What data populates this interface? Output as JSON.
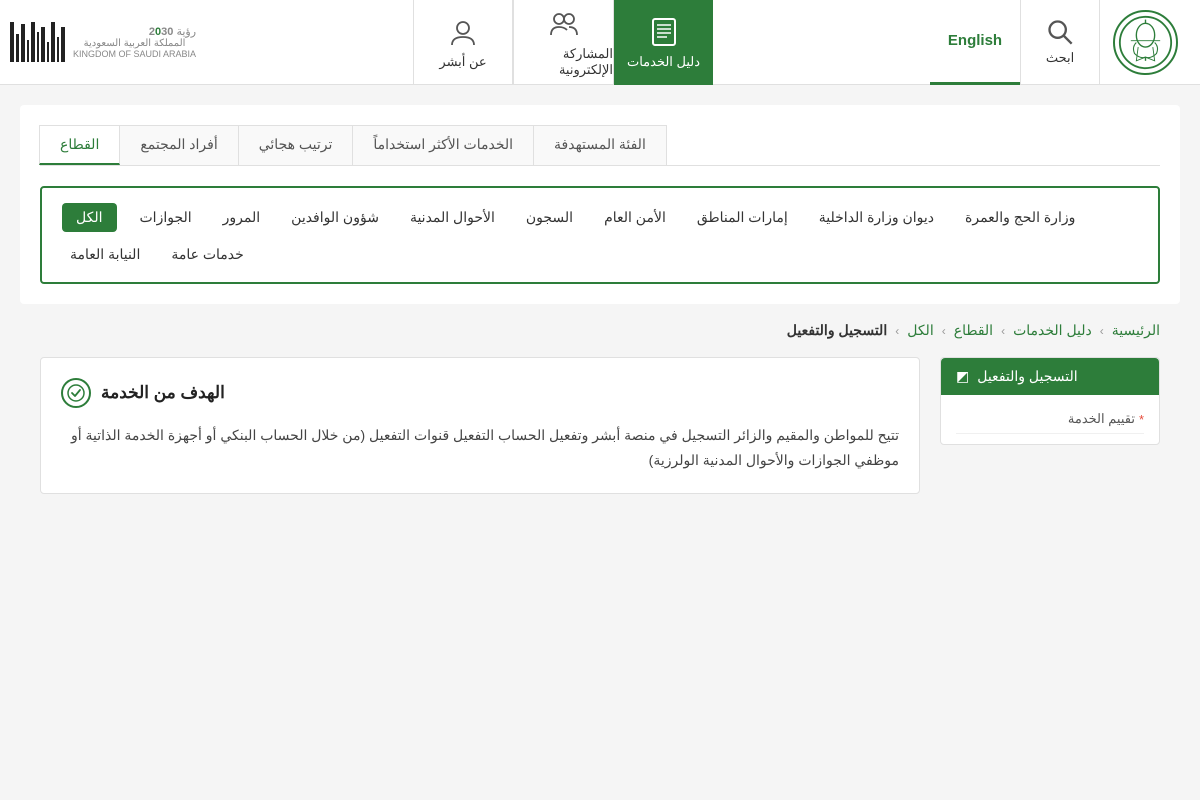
{
  "header": {
    "search_label": "ابحث",
    "english_label": "English",
    "nav_items": [
      {
        "id": "daleel",
        "label": "دليل الخدمات",
        "icon": "book",
        "active": true
      },
      {
        "id": "musharaka",
        "label": "المشاركة الإلكترونية",
        "icon": "people",
        "active": false
      },
      {
        "id": "absher",
        "label": "عن أبشر",
        "icon": "id",
        "active": false
      }
    ],
    "vision_line1": "رؤية",
    "vision_year": "2030",
    "vision_country": "المملكة العربية السعودية",
    "vision_en": "KINGDOM OF SAUDI ARABIA"
  },
  "filter_tabs": [
    {
      "id": "qita3",
      "label": "القطاع",
      "active": true
    },
    {
      "id": "afrad",
      "label": "أفراد المجتمع",
      "active": false
    },
    {
      "id": "tartib",
      "label": "ترتيب هجائي",
      "active": false
    },
    {
      "id": "akthar",
      "label": "الخدمات الأكثر استخداماً",
      "active": false
    },
    {
      "id": "fi2a",
      "label": "الفئة المستهدفة",
      "active": false
    }
  ],
  "categories": {
    "row1": [
      {
        "id": "all",
        "label": "الكل",
        "active": true
      },
      {
        "id": "jawazat",
        "label": "الجوازات",
        "active": false
      },
      {
        "id": "muroor",
        "label": "المرور",
        "active": false
      },
      {
        "id": "shu2oon",
        "label": "شؤون الوافدين",
        "active": false
      },
      {
        "id": "ahwal",
        "label": "الأحوال المدنية",
        "active": false
      },
      {
        "id": "sujoon",
        "label": "السجون",
        "active": false
      },
      {
        "id": "amn",
        "label": "الأمن العام",
        "active": false
      },
      {
        "id": "imaraat",
        "label": "إمارات المناطق",
        "active": false
      },
      {
        "id": "diwan",
        "label": "ديوان وزارة الداخلية",
        "active": false
      },
      {
        "id": "hajj",
        "label": "وزارة الحج والعمرة",
        "active": false
      }
    ],
    "row2": [
      {
        "id": "niyaba",
        "label": "النيابة العامة",
        "active": false
      },
      {
        "id": "khadamat",
        "label": "خدمات عامة",
        "active": false
      }
    ]
  },
  "breadcrumb": [
    {
      "id": "home",
      "label": "الرئيسية"
    },
    {
      "id": "daleel",
      "label": "دليل الخدمات"
    },
    {
      "id": "qita3",
      "label": "القطاع"
    },
    {
      "id": "all",
      "label": "الكل"
    },
    {
      "id": "current",
      "label": "التسجيل والتفعيل"
    }
  ],
  "service_sidebar": {
    "title": "التسجيل والتفعيل",
    "title_icon": "◩",
    "sub_label": "تقييم الخدمة",
    "star_indicator": "*"
  },
  "service_main": {
    "title": "الهدف من الخدمة",
    "title_icon": "✓",
    "description": "تتيح للمواطن والمقيم والزائر التسجيل في منصة أبشر وتفعيل الحساب التفعيل قنوات التفعيل (من خلال الحساب البنكي أو أجهزة الخدمة الذاتية أو موظفي الجوازات والأحوال المدنية الولرزية)"
  }
}
